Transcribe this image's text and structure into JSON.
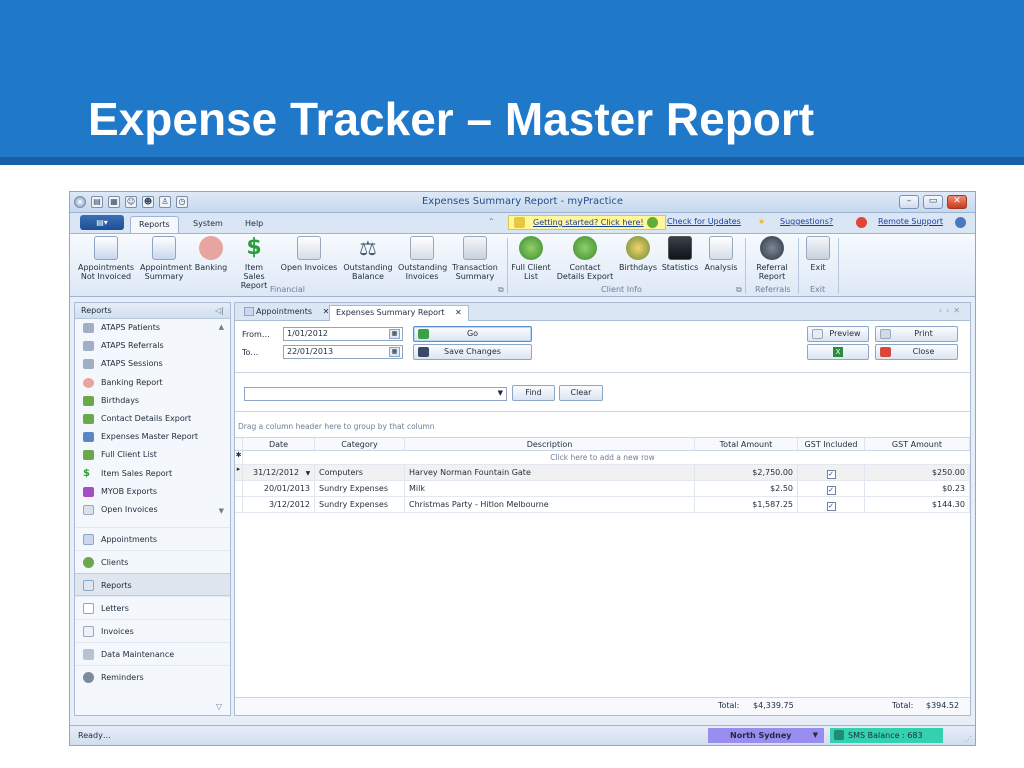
{
  "slide": {
    "title": "Expense Tracker – Master Report"
  },
  "window": {
    "title": "Expenses Summary Report - myPractice",
    "controls": {
      "minimize": "–",
      "maximize": "▭",
      "close": "✕"
    }
  },
  "menubar": {
    "tabs": [
      "Reports",
      "System",
      "Help"
    ],
    "getting_started": "Getting started? Click here!",
    "check_updates": "Check for Updates",
    "suggestions": "Suggestions?",
    "remote_support": "Remote Support"
  },
  "ribbon": {
    "buttons": [
      {
        "label1": "Appointments",
        "label2": "Not Invoiced"
      },
      {
        "label1": "Appointment",
        "label2": "Summary"
      },
      {
        "label1": "Banking",
        "label2": ""
      },
      {
        "label1": "Item Sales",
        "label2": "Report"
      },
      {
        "label1": "Open Invoices",
        "label2": ""
      },
      {
        "label1": "Outstanding",
        "label2": "Balance"
      },
      {
        "label1": "Outstanding",
        "label2": "Invoices"
      },
      {
        "label1": "Transaction",
        "label2": "Summary"
      },
      {
        "label1": "Full Client",
        "label2": "List"
      },
      {
        "label1": "Contact",
        "label2": "Details Export"
      },
      {
        "label1": "Birthdays",
        "label2": ""
      },
      {
        "label1": "Statistics",
        "label2": ""
      },
      {
        "label1": "Analysis",
        "label2": ""
      },
      {
        "label1": "Referral",
        "label2": "Report"
      },
      {
        "label1": "Exit",
        "label2": ""
      }
    ],
    "groups": [
      "Financial",
      "Client Info",
      "Referrals",
      "Exit"
    ]
  },
  "sidebar": {
    "header": "Reports",
    "reports": [
      "ATAPS Patients",
      "ATAPS Referrals",
      "ATAPS Sessions",
      "Banking Report",
      "Birthdays",
      "Contact Details Export",
      "Expenses Master Report",
      "Full Client List",
      "Item Sales Report",
      "MYOB Exports",
      "Open Invoices"
    ],
    "nav": [
      "Appointments",
      "Clients",
      "Reports",
      "Letters",
      "Invoices",
      "Data Maintenance",
      "Reminders"
    ]
  },
  "doc_tabs": [
    "Appointments",
    "Expenses Summary Report"
  ],
  "filters": {
    "from_label": "From…",
    "from_value": "1/01/2012",
    "to_label": "To…",
    "to_value": "22/01/2013",
    "go": "Go",
    "save": "Save Changes",
    "preview": "Preview",
    "print": "Print",
    "close": "Close",
    "find": "Find",
    "clear": "Clear",
    "group_hint": "Drag a column header here to group by that column"
  },
  "grid": {
    "columns": [
      "Date",
      "Category",
      "Description",
      "Total Amount",
      "GST Included",
      "GST Amount"
    ],
    "new_row_hint": "Click here to add a new row",
    "rows": [
      {
        "date": "31/12/2012",
        "category": "Computers",
        "description": "Harvey Norman Fountain Gate",
        "total": "$2,750.00",
        "gst_included": true,
        "gst": "$250.00"
      },
      {
        "date": "20/01/2013",
        "category": "Sundry Expenses",
        "description": "Milk",
        "total": "$2.50",
        "gst_included": true,
        "gst": "$0.23"
      },
      {
        "date": "3/12/2012",
        "category": "Sundry Expenses",
        "description": "Christmas Party - Hitlon Melbourne",
        "total": "$1,587.25",
        "gst_included": true,
        "gst": "$144.30"
      }
    ],
    "totals": {
      "label": "Total:",
      "total_amount": "$4,339.75",
      "gst_amount": "$394.52"
    }
  },
  "status": {
    "ready": "Ready…",
    "location": "North Sydney",
    "sms": "SMS Balance : 683"
  }
}
